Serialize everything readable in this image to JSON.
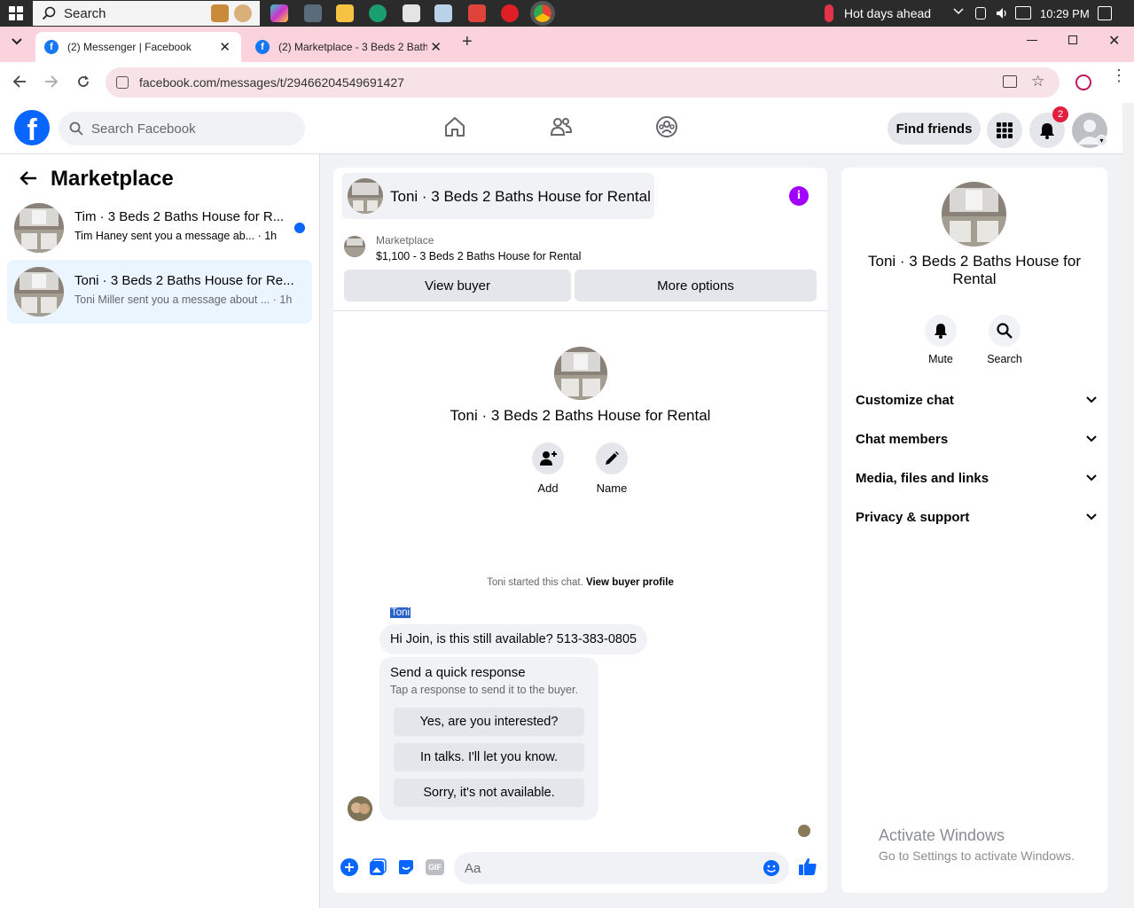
{
  "taskbar": {
    "search_placeholder": "Search",
    "weather": "Hot days ahead",
    "time": "10:29 PM"
  },
  "browser": {
    "tabs": [
      {
        "title": "(2) Messenger | Facebook",
        "active": true
      },
      {
        "title": "(2) Marketplace - 3 Beds 2 Bath",
        "active": false
      }
    ],
    "url": "facebook.com/messages/t/29466204549691427"
  },
  "fb": {
    "search_placeholder": "Search Facebook",
    "find_friends": "Find friends",
    "notification_count": "2"
  },
  "sidebar": {
    "title": "Marketplace",
    "conversations": [
      {
        "title": "Tim · 3 Beds 2 Baths House for R...",
        "snippet": "Tim Haney sent you a message ab...",
        "time": "· 1h",
        "unread": true
      },
      {
        "title": "Toni · 3 Beds 2 Baths House for Re...",
        "snippet": "Toni Miller sent you a message about ...",
        "time": "· 1h",
        "unread": false
      }
    ]
  },
  "chat": {
    "header_title": "Toni · 3 Beds 2 Baths House for Rental",
    "marketplace_label": "Marketplace",
    "listing": "$1,100 - 3 Beds 2 Baths House for Rental",
    "view_buyer": "View buyer",
    "more_options": "More options",
    "profile_title": "Toni · 3 Beds 2 Baths House for Rental",
    "add_label": "Add",
    "name_label": "Name",
    "started_text": "Toni started this chat.",
    "view_profile": "View buyer profile",
    "sender_name": "Toni",
    "message": "Hi Join, is this still available? 513-383-0805",
    "quick_title": "Send a quick response",
    "quick_sub": "Tap a response to send it to the buyer.",
    "quick_replies": [
      "Yes, are you interested?",
      "In talks. I'll let you know.",
      "Sorry, it's not available."
    ],
    "composer_placeholder": "Aa"
  },
  "details": {
    "title": "Toni · 3 Beds 2 Baths House for Rental",
    "mute": "Mute",
    "search": "Search",
    "sections": [
      "Customize chat",
      "Chat members",
      "Media, files and links",
      "Privacy & support"
    ]
  },
  "watermark": {
    "line1": "Activate Windows",
    "line2": "Go to Settings to activate Windows."
  },
  "colors": {
    "fb_blue": "#0866ff",
    "tab_strip": "#fbd3dd",
    "info_purple": "#a100ff",
    "badge_red": "#e41e3f"
  }
}
